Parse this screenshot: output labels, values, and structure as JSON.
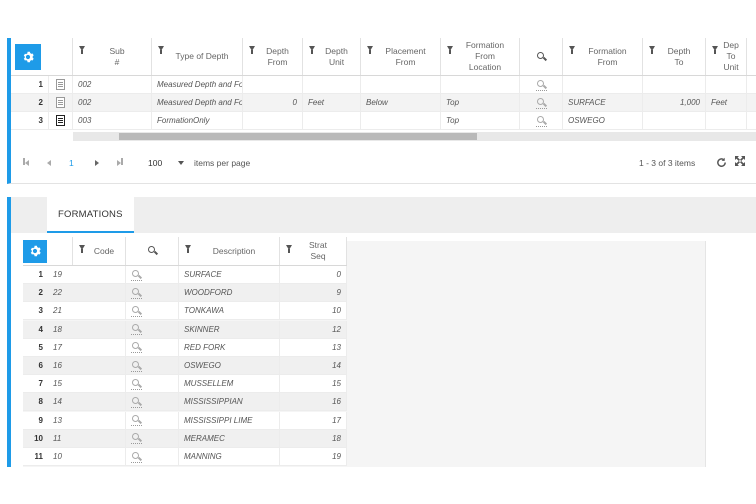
{
  "top_grid": {
    "columns": [
      {
        "key": "sub",
        "label": "Sub\n#",
        "filter": true
      },
      {
        "key": "type",
        "label": "Type of Depth",
        "filter": true
      },
      {
        "key": "depth_from",
        "label": "Depth\nFrom",
        "filter": true
      },
      {
        "key": "depth_unit",
        "label": "Depth\nUnit",
        "filter": true
      },
      {
        "key": "placement_from",
        "label": "Placement\nFrom",
        "filter": true
      },
      {
        "key": "formation_from_location",
        "label": "Formation\nFrom\nLocation",
        "filter": true
      },
      {
        "key": "lookup",
        "label": "",
        "filter": false
      },
      {
        "key": "formation_from",
        "label": "Formation\nFrom",
        "filter": true
      },
      {
        "key": "depth_to",
        "label": "Depth\nTo",
        "filter": true
      },
      {
        "key": "depth_to_unit",
        "label": "Dep\nTo\nUnit",
        "filter": true
      }
    ],
    "rows": [
      {
        "num": "1",
        "sub": "002",
        "type": "Measured Depth and Formati...",
        "depth_from": "",
        "depth_unit": "",
        "placement_from": "",
        "formation_from_location": "",
        "formation_from": "",
        "depth_to": "",
        "depth_to_unit": ""
      },
      {
        "num": "2",
        "sub": "002",
        "type": "Measured Depth and Formati...",
        "depth_from": "0",
        "depth_unit": "Feet",
        "placement_from": "Below",
        "formation_from_location": "Top",
        "formation_from": "SURFACE",
        "depth_to": "1,000",
        "depth_to_unit": "Feet"
      },
      {
        "num": "3",
        "sub": "003",
        "type": "FormationOnly",
        "depth_from": "",
        "depth_unit": "",
        "placement_from": "",
        "formation_from_location": "Top",
        "formation_from": "OSWEGO",
        "depth_to": "",
        "depth_to_unit": ""
      }
    ],
    "pager": {
      "current_page": "1",
      "page_size": "100",
      "items_per_page_label": "items per page",
      "summary": "1 - 3 of 3 items"
    }
  },
  "formations_tab": {
    "tab_label": "FORMATIONS",
    "columns": [
      {
        "key": "code",
        "label": "Code",
        "filter": true
      },
      {
        "key": "lookup",
        "label": "",
        "filter": false
      },
      {
        "key": "description",
        "label": "Description",
        "filter": true
      },
      {
        "key": "strat_seq",
        "label": "Strat\nSeq",
        "filter": true
      }
    ],
    "rows": [
      {
        "num": "1",
        "code": "19",
        "description": "SURFACE",
        "strat_seq": "0"
      },
      {
        "num": "2",
        "code": "22",
        "description": "WOODFORD",
        "strat_seq": "9"
      },
      {
        "num": "3",
        "code": "21",
        "description": "TONKAWA",
        "strat_seq": "10"
      },
      {
        "num": "4",
        "code": "18",
        "description": "SKINNER",
        "strat_seq": "12"
      },
      {
        "num": "5",
        "code": "17",
        "description": "RED FORK",
        "strat_seq": "13"
      },
      {
        "num": "6",
        "code": "16",
        "description": "OSWEGO",
        "strat_seq": "14"
      },
      {
        "num": "7",
        "code": "15",
        "description": "MUSSELLEM",
        "strat_seq": "15"
      },
      {
        "num": "8",
        "code": "14",
        "description": "MISSISSIPPIAN",
        "strat_seq": "16"
      },
      {
        "num": "9",
        "code": "13",
        "description": "MISSISSIPPI LIME",
        "strat_seq": "17"
      },
      {
        "num": "10",
        "code": "11",
        "description": "MERAMEC",
        "strat_seq": "18"
      },
      {
        "num": "11",
        "code": "10",
        "description": "MANNING",
        "strat_seq": "19"
      }
    ]
  },
  "colors": {
    "accent": "#1e9be8",
    "alt_row": "#f3f3f3"
  },
  "icons": [
    "gear-icon",
    "filter-icon",
    "magnifier-icon",
    "document-icon",
    "refresh-icon",
    "expand-icon"
  ]
}
